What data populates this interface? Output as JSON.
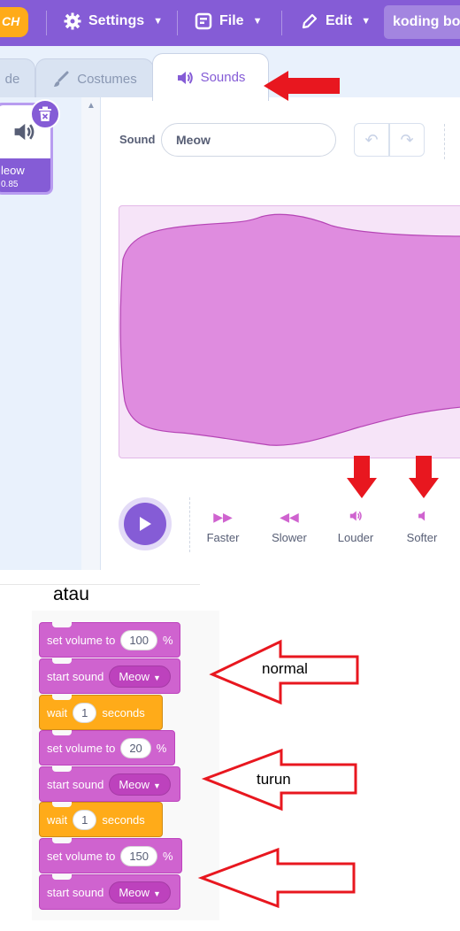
{
  "menubar": {
    "logo_text": "CH",
    "settings_label": "Settings",
    "file_label": "File",
    "edit_label": "Edit",
    "project_title": "koding bo"
  },
  "tabs": {
    "code_label": "de",
    "costumes_label": "Costumes",
    "sounds_label": "Sounds"
  },
  "sound_list": {
    "name": "leow",
    "duration": "0.85"
  },
  "editor": {
    "sound_label": "Sound",
    "sound_name": "Meow",
    "effects": [
      "Faster",
      "Slower",
      "Louder",
      "Softer"
    ]
  },
  "blocks": {
    "atau": "atau",
    "set_volume_label": "set volume to",
    "percent": "%",
    "start_sound_label": "start sound",
    "sound_option": "Meow",
    "wait_label": "wait",
    "seconds_label": "seconds",
    "volumes": [
      "100",
      "20",
      "150"
    ],
    "wait_values": [
      "1",
      "1"
    ]
  },
  "annotations": {
    "normal": "normal",
    "turun": "turun"
  },
  "colors": {
    "menu_purple": "#855cd6",
    "sound_block": "#cf63cf",
    "control_block": "#ffab19",
    "arrow_red": "#e8171f"
  }
}
